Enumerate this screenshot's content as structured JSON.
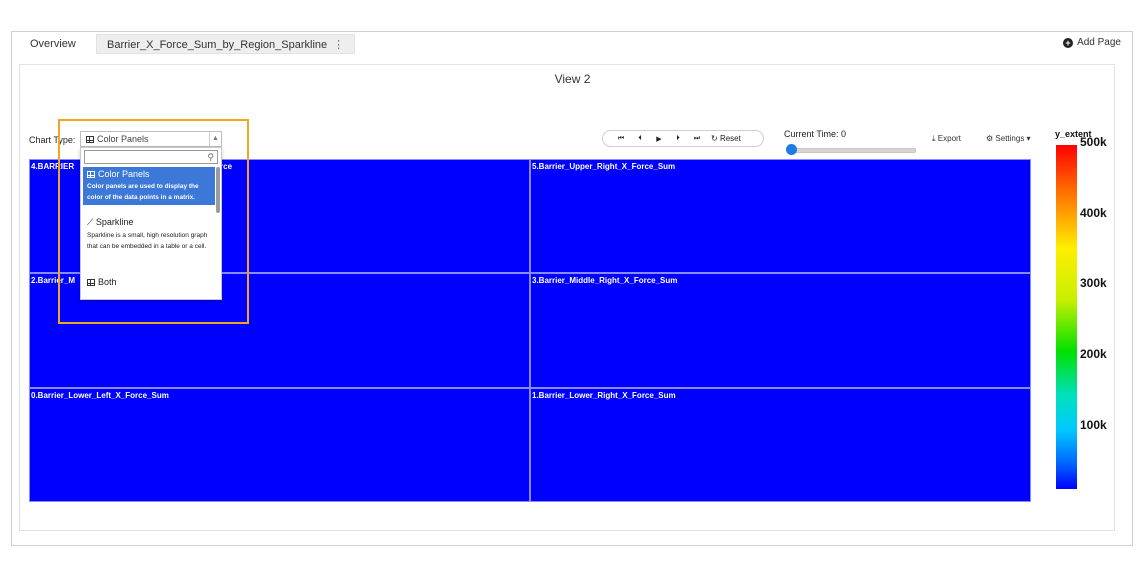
{
  "tabs": [
    {
      "label": "Overview",
      "active": false
    },
    {
      "label": "Barrier_X_Force_Sum_by_Region_Sparkline",
      "active": true
    }
  ],
  "tab_menu_glyph": "⋮",
  "add_page": {
    "label": "Add Page",
    "icon": "plus-circle-icon"
  },
  "view_title": "View 2",
  "chart_type": {
    "label": "Chart Type:",
    "selected": "Color Panels",
    "options": [
      {
        "label": "Color Panels",
        "description": "Color panels are used to display the color of the data points in a matrix.",
        "selected": true
      },
      {
        "label": "Sparkline",
        "description": "Sparkline is a small, high resolution graph that can be embedded in a table or a cell.",
        "selected": false
      },
      {
        "label": "Both",
        "description": "",
        "selected": false
      }
    ]
  },
  "player": {
    "buttons": [
      "first-icon",
      "prev-icon",
      "play-icon",
      "next-icon",
      "last-icon"
    ],
    "glyphs": [
      "⏮",
      "⏴",
      "▶",
      "⏵",
      "⏭"
    ],
    "reset_label": "Reset"
  },
  "current_time": {
    "label": "Current Time: 0",
    "value": 0
  },
  "export_label": "Export",
  "settings_label": "Settings",
  "panels": [
    {
      "label": "4.BARRIER_Upper_Left_X_Force",
      "visible_label": "4.BARRIER",
      "visible_label_tail": "rce",
      "color": "#0000ff"
    },
    {
      "label": "5.Barrier_Upper_Right_X_Force_Sum",
      "color": "#0000ff"
    },
    {
      "label": "2.Barrier_Middle_Left_X_Force_Sum",
      "visible_label": "2.Barrier_M",
      "color": "#0000ff"
    },
    {
      "label": "3.Barrier_Middle_Right_X_Force_Sum",
      "color": "#0000ff"
    },
    {
      "label": "0.Barrier_Lower_Left_X_Force_Sum",
      "color": "#0000ff"
    },
    {
      "label": "1.Barrier_Lower_Right_X_Force_Sum",
      "color": "#0000ff"
    }
  ],
  "legend": {
    "title": "y_extent",
    "ticks": [
      "500k",
      "400k",
      "300k",
      "200k",
      "100k"
    ],
    "colors": [
      "#ff0000",
      "#ffee00",
      "#00e000",
      "#00c8ff",
      "#0000ff"
    ]
  },
  "colors": {
    "panel_blue": "#0000ff",
    "highlight": "#f0a623",
    "accent": "#3b78d8"
  }
}
